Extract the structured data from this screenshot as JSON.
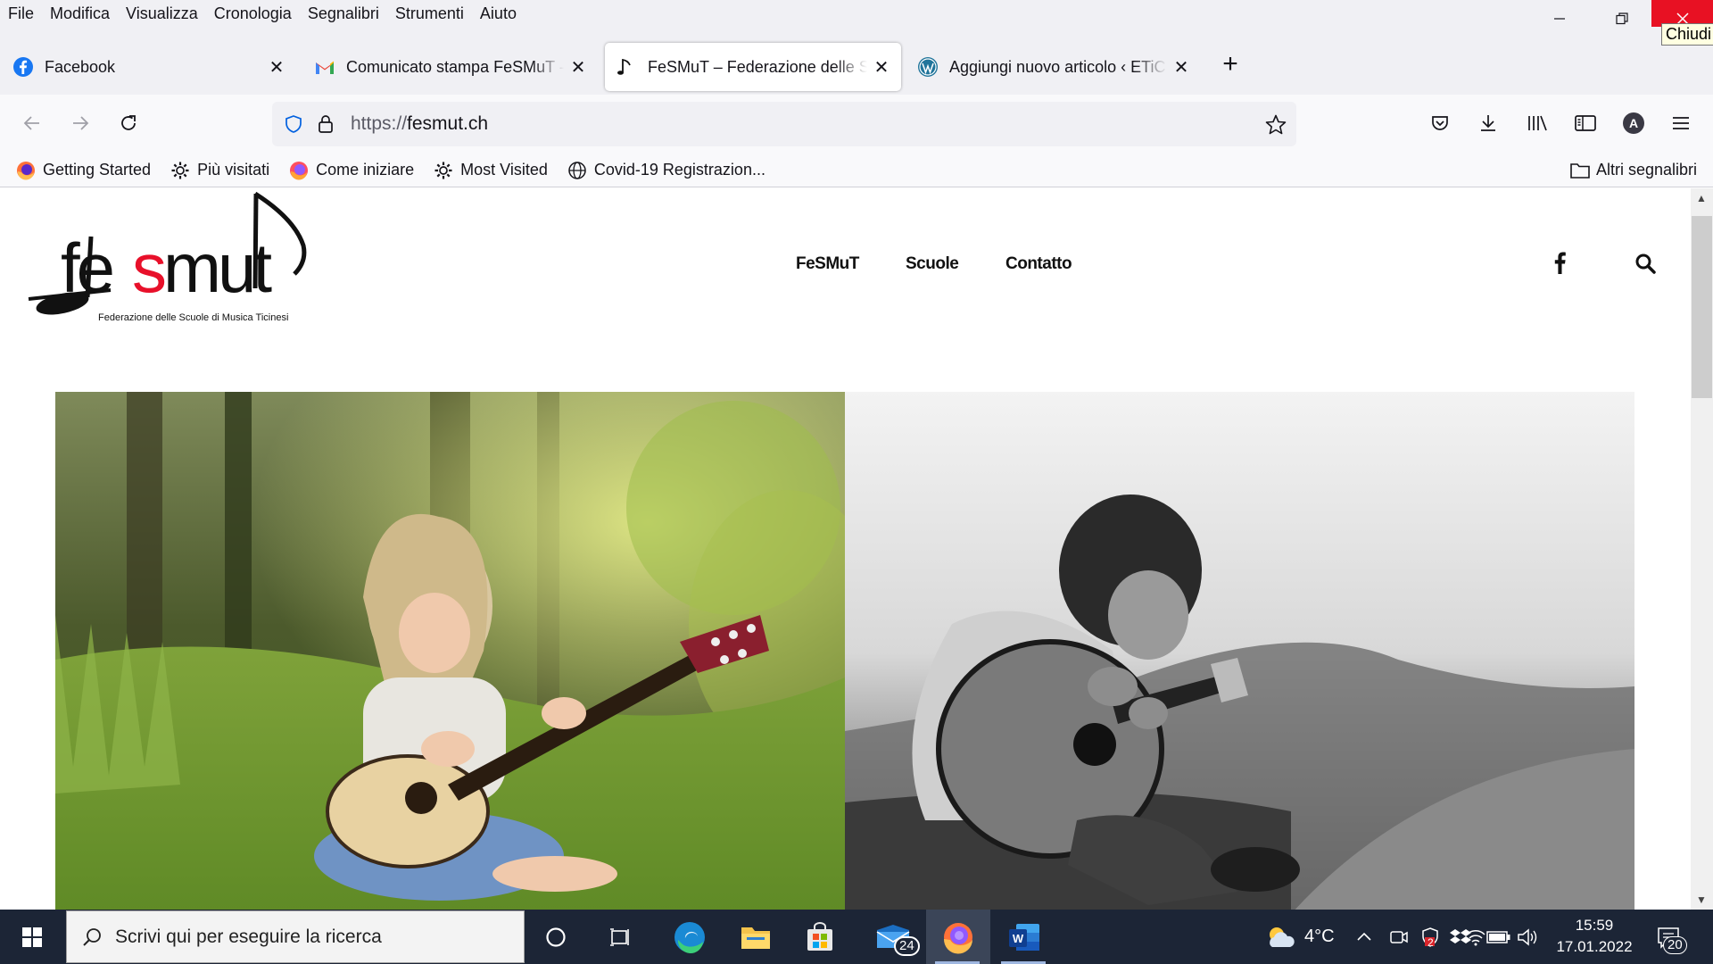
{
  "menubar": {
    "items": [
      "File",
      "Modifica",
      "Visualizza",
      "Cronologia",
      "Segnalibri",
      "Strumenti",
      "Aiuto"
    ],
    "close_tooltip": "Chiudi"
  },
  "tabs": [
    {
      "title": "Facebook",
      "icon": "facebook-icon"
    },
    {
      "title": "Comunicato stampa FeSMuT - a",
      "icon": "gmail-icon"
    },
    {
      "title": "FeSMuT – Federazione delle Scuole",
      "icon": "music-note-icon",
      "active": true
    },
    {
      "title": "Aggiungi nuovo articolo ‹ ETiCinema",
      "icon": "wordpress-icon"
    }
  ],
  "navbar": {
    "url_protocol": "https://",
    "url_host": "fesmut.ch"
  },
  "bookmarks": {
    "items": [
      {
        "label": "Getting Started",
        "icon": "firefox-icon"
      },
      {
        "label": "Più visitati",
        "icon": "gear-icon"
      },
      {
        "label": "Come iniziare",
        "icon": "firefox-icon"
      },
      {
        "label": "Most Visited",
        "icon": "gear-icon"
      },
      {
        "label": "Covid-19 Registrazion...",
        "icon": "globe-icon"
      }
    ],
    "other": "Altri segnalibri"
  },
  "site": {
    "logo_text": "fesmut",
    "logo_subtitle": "Federazione delle Scuole di Musica Ticinesi",
    "nav": [
      "FeSMuT",
      "Scuole",
      "Contatto"
    ]
  },
  "taskbar": {
    "search_placeholder": "Scrivi qui per eseguire la ricerca",
    "mail_badge": "24",
    "weather": "4°C",
    "time": "15:59",
    "date": "17.01.2022",
    "notification_count": "20",
    "tray_badge": "2"
  },
  "colors": {
    "accent_red": "#e8102a",
    "close_red": "#e81123",
    "taskbar": "#1c2536"
  }
}
